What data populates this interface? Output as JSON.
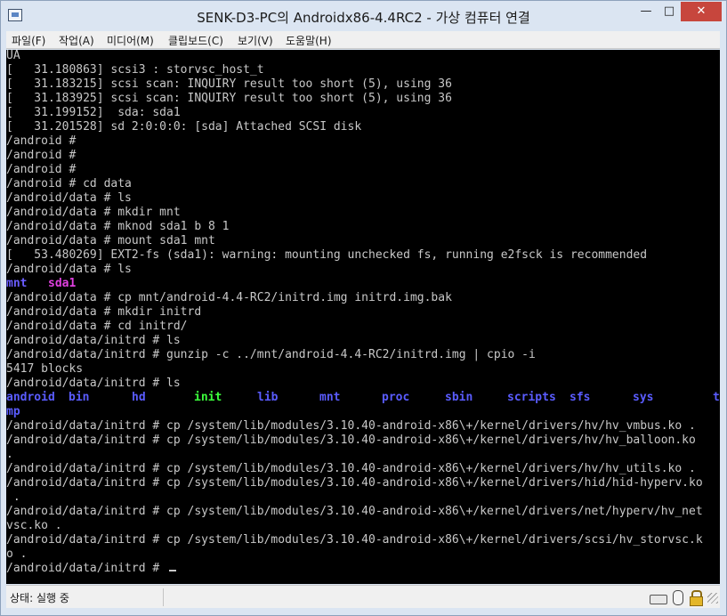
{
  "window": {
    "title": "SENK-D3-PC의 Androidx86-4.4RC2 - 가상 컴퓨터 연결",
    "minimize_glyph": "—",
    "maximize_glyph": "□",
    "close_glyph": "✕"
  },
  "menu": [
    "파일(F)",
    "작업(A)",
    "미디어(M)",
    "클립보드(C)",
    "보기(V)",
    "도움말(H)"
  ],
  "console": {
    "lines": [
      "UA",
      "[   31.180863] scsi3 : storvsc_host_t",
      "[   31.183215] scsi scan: INQUIRY result too short (5), using 36",
      "[   31.183925] scsi scan: INQUIRY result too short (5), using 36",
      "[   31.199152]  sda: sda1",
      "[   31.201528] sd 2:0:0:0: [sda] Attached SCSI disk",
      "/android #",
      "/android #",
      "/android #",
      "/android # cd data",
      "/android/data # ls",
      "/android/data # mkdir mnt",
      "/android/data # mknod sda1 b 8 1",
      "/android/data # mount sda1 mnt",
      "[   53.480269] EXT2-fs (sda1): warning: mounting unchecked fs, running e2fsck is recommended",
      "/android/data # ls",
      "",
      "/android/data # cp mnt/android-4.4-RC2/initrd.img initrd.img.bak",
      "/android/data # mkdir initrd",
      "/android/data # cd initrd/",
      "/android/data/initrd # ls",
      "/android/data/initrd # gunzip -c ../mnt/android-4.4-RC2/initrd.img | cpio -i",
      "5417 blocks",
      "/android/data/initrd # ls",
      "",
      "",
      "/android/data/initrd # cp /system/lib/modules/3.10.40-android-x86\\+/kernel/drivers/hv/hv_vmbus.ko .",
      "/android/data/initrd # cp /system/lib/modules/3.10.40-android-x86\\+/kernel/drivers/hv/hv_balloon.ko",
      ".",
      "/android/data/initrd # cp /system/lib/modules/3.10.40-android-x86\\+/kernel/drivers/hv/hv_utils.ko .",
      "/android/data/initrd # cp /system/lib/modules/3.10.40-android-x86\\+/kernel/drivers/hid/hid-hyperv.ko",
      " .",
      "/android/data/initrd # cp /system/lib/modules/3.10.40-android-x86\\+/kernel/drivers/net/hyperv/hv_net",
      "vsc.ko .",
      "/android/data/initrd # cp /system/lib/modules/3.10.40-android-x86\\+/kernel/drivers/scsi/hv_storvsc.k",
      "o .",
      "/android/data/initrd #"
    ],
    "ls_data": [
      {
        "name": "mnt",
        "color": "#6a5cff"
      },
      {
        "name": "sda1",
        "color": "#e040e0"
      }
    ],
    "ls_initrd": [
      {
        "name": "android",
        "color": "#5a5cff"
      },
      {
        "name": "bin",
        "color": "#5a5cff"
      },
      {
        "name": "hd",
        "color": "#5a5cff"
      },
      {
        "name": "init",
        "color": "#3cff3c"
      },
      {
        "name": "lib",
        "color": "#5a5cff"
      },
      {
        "name": "mnt",
        "color": "#5a5cff"
      },
      {
        "name": "proc",
        "color": "#5a5cff"
      },
      {
        "name": "sbin",
        "color": "#5a5cff"
      },
      {
        "name": "scripts",
        "color": "#5a5cff"
      },
      {
        "name": "sfs",
        "color": "#5a5cff"
      },
      {
        "name": "sys",
        "color": "#5a5cff"
      },
      {
        "name": "t",
        "color": "#5a5cff"
      }
    ],
    "ls_initrd_wrap": {
      "name": "mp",
      "color": "#5a5cff"
    },
    "text_color": "#c8c8c8",
    "background": "#000000"
  },
  "status": {
    "text": "상태: 실행 중",
    "icons": [
      "keyboard-icon",
      "mouse-icon",
      "lock-icon",
      "resize-grip-icon"
    ]
  }
}
